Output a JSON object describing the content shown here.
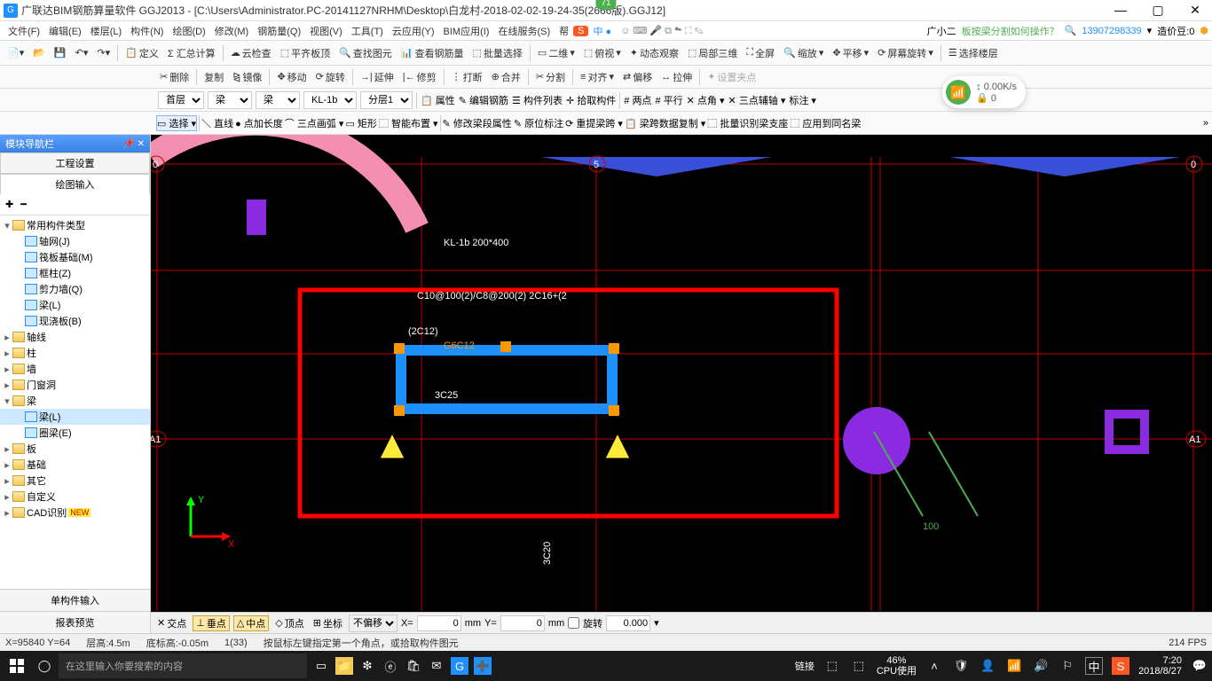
{
  "title": "广联达BIM钢筋算量软件 GGJ2013 - [C:\\Users\\Administrator.PC-20141127NRHM\\Desktop\\白龙村-2018-02-02-19-24-35(2666版).GGJ12]",
  "top_badge": "71",
  "menus": [
    "文件(F)",
    "编辑(E)",
    "楼层(L)",
    "构件(N)",
    "绘图(D)",
    "修改(M)",
    "钢筋量(Q)",
    "视图(V)",
    "工具(T)",
    "云应用(Y)",
    "BIM应用(I)",
    "在线服务(S)",
    "帮"
  ],
  "menu_right": {
    "user": "广小二",
    "question": "板按梁分割如何操作？",
    "phone": "13907298339",
    "credit_label": "造价豆:0"
  },
  "toolbar2": [
    "定义",
    "Σ 汇总计算",
    "云检查",
    "平齐板顶",
    "查找图元",
    "查看钢筋量",
    "批量选择",
    "二维",
    "俯视",
    "动态观察",
    "局部三维",
    "全屏",
    "缩放",
    "平移",
    "屏幕旋转",
    "选择楼层"
  ],
  "toolbar3": [
    "删除",
    "复制",
    "镜像",
    "移动",
    "旋转",
    "延伸",
    "修剪",
    "打断",
    "合并",
    "分割",
    "对齐",
    "偏移",
    "拉伸",
    "设置夹点"
  ],
  "selectors": {
    "floor": "首层",
    "cat1": "梁",
    "cat2": "梁",
    "member": "KL-1b",
    "layer": "分层1",
    "tools": [
      "属性",
      "编辑钢筋",
      "构件列表",
      "拾取构件",
      "两点",
      "平行",
      "点角",
      "三点辅轴",
      "标注"
    ]
  },
  "toolbar4": {
    "select": "选择",
    "items": [
      "直线",
      "点加长度",
      "三点画弧",
      "矩形",
      "智能布置",
      "修改梁段属性",
      "原位标注",
      "重提梁跨",
      "梁跨数据复制",
      "批量识别梁支座",
      "应用到同名梁"
    ]
  },
  "net": {
    "speed": "0.00K/s",
    "count": "0"
  },
  "sidebar": {
    "header": "模块导航栏",
    "tabs": [
      "工程设置",
      "绘图输入"
    ],
    "tree": [
      {
        "d": 0,
        "tw": "▾",
        "ico": "fold",
        "label": "常用构件类型"
      },
      {
        "d": 1,
        "tw": "",
        "ico": "grid",
        "label": "轴网(J)"
      },
      {
        "d": 1,
        "tw": "",
        "ico": "grid",
        "label": "筏板基础(M)"
      },
      {
        "d": 1,
        "tw": "",
        "ico": "col",
        "label": "框柱(Z)"
      },
      {
        "d": 1,
        "tw": "",
        "ico": "wall",
        "label": "剪力墙(Q)"
      },
      {
        "d": 1,
        "tw": "",
        "ico": "beam",
        "label": "梁(L)"
      },
      {
        "d": 1,
        "tw": "",
        "ico": "slab",
        "label": "现浇板(B)"
      },
      {
        "d": 0,
        "tw": "▸",
        "ico": "fold",
        "label": "轴线"
      },
      {
        "d": 0,
        "tw": "▸",
        "ico": "fold",
        "label": "柱"
      },
      {
        "d": 0,
        "tw": "▸",
        "ico": "fold",
        "label": "墙"
      },
      {
        "d": 0,
        "tw": "▸",
        "ico": "fold",
        "label": "门窗洞"
      },
      {
        "d": 0,
        "tw": "▾",
        "ico": "fold",
        "label": "梁"
      },
      {
        "d": 1,
        "tw": "",
        "ico": "beam",
        "label": "梁(L)",
        "sel": true
      },
      {
        "d": 1,
        "tw": "",
        "ico": "ring",
        "label": "圈梁(E)"
      },
      {
        "d": 0,
        "tw": "▸",
        "ico": "fold",
        "label": "板"
      },
      {
        "d": 0,
        "tw": "▸",
        "ico": "fold",
        "label": "基础"
      },
      {
        "d": 0,
        "tw": "▸",
        "ico": "fold",
        "label": "其它"
      },
      {
        "d": 0,
        "tw": "▸",
        "ico": "fold",
        "label": "自定义"
      },
      {
        "d": 0,
        "tw": "▸",
        "ico": "fold",
        "label": "CAD识别",
        "new": true
      }
    ],
    "bottom": [
      "单构件输入",
      "报表预览"
    ]
  },
  "canvas": {
    "labels": {
      "kl": "KL-1b  200*400",
      "l2": "C10@100(2)/C8@200(2)  2C16+(2",
      "l3": "(2C12)",
      "l4": "G6C12",
      "l5": "3C25",
      "l6": "3C20",
      "dim": "100",
      "a1_l": "A1",
      "a1_r": "A1",
      "z0_l": "0",
      "z5": "5",
      "z0_r": "0",
      "axis_x": "X",
      "axis_y": "Y"
    }
  },
  "bottom_opts": {
    "items": [
      "交点",
      "垂点",
      "中点",
      "顶点",
      "坐标"
    ],
    "on": [
      1,
      2
    ],
    "offset": "不偏移",
    "x": "0",
    "y": "0",
    "rot_label": "旋转",
    "rot": "0.000"
  },
  "status": {
    "coord": "X=95840 Y=64",
    "floor_h": "层高:4.5m",
    "bottom_h": "底标高:-0.05m",
    "sel": "1(33)",
    "hint": "按鼠标左键指定第一个角点，或拾取构件图元",
    "fps": "214 FPS"
  },
  "taskbar": {
    "search_ph": "在这里输入你要搜索的内容",
    "link": "链接",
    "cpu_pct": "46%",
    "cpu_lbl": "CPU使用",
    "ime": "中",
    "time": "7:20",
    "date": "2018/8/27"
  }
}
